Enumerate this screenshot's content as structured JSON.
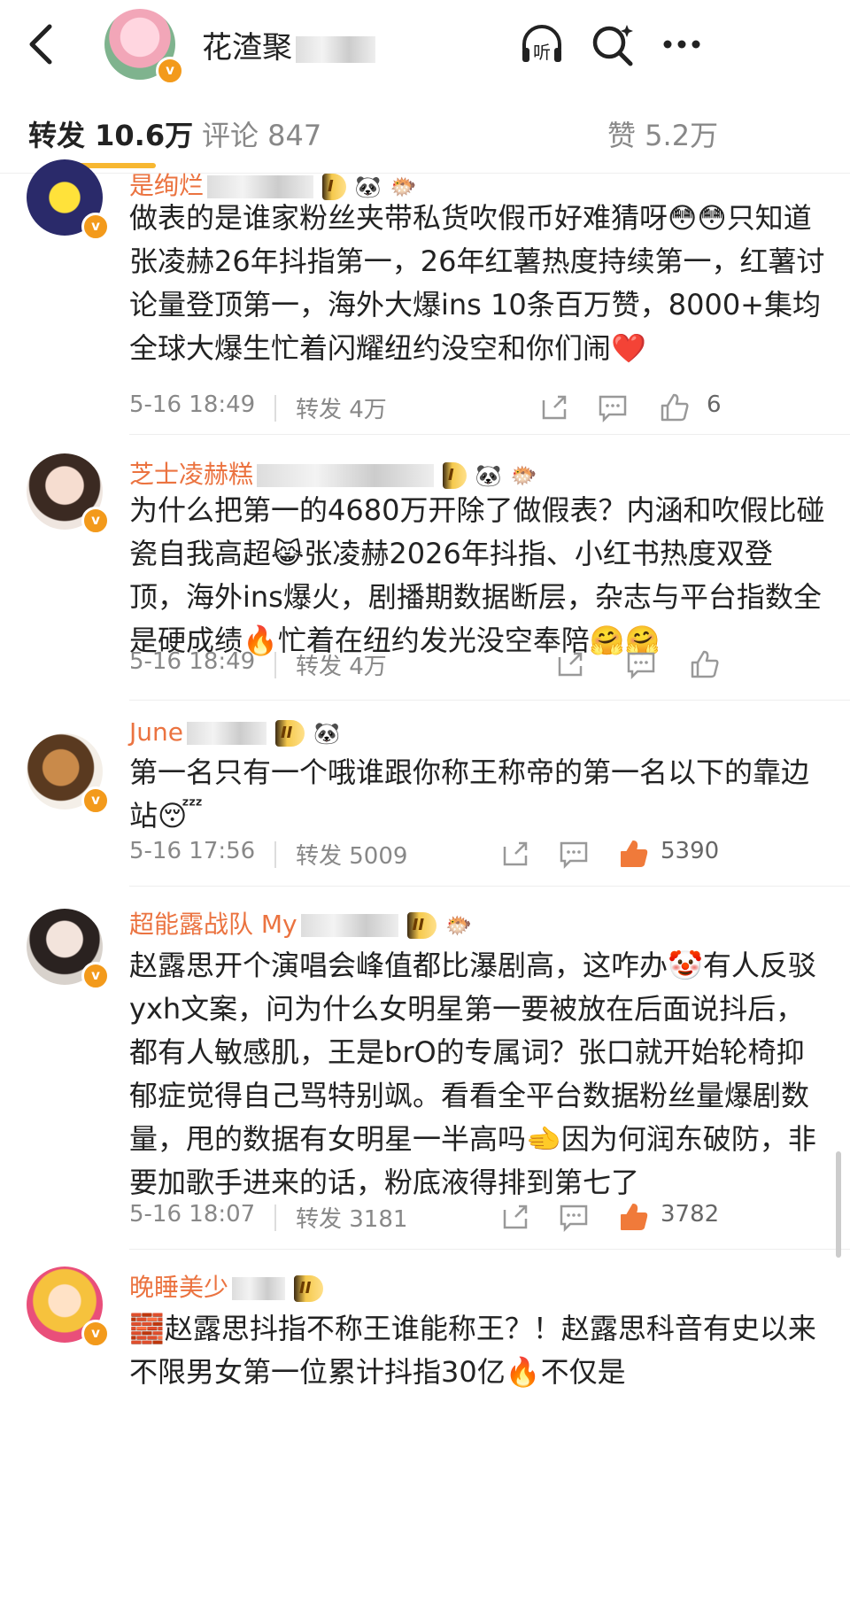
{
  "header": {
    "title": "花渣聚",
    "listen_label": "听"
  },
  "tabs": [
    {
      "label": "转发 10.6万",
      "active": true
    },
    {
      "label": "评论 847",
      "active": false
    },
    {
      "label": "赞 5.2万",
      "active": false
    }
  ],
  "comments": [
    {
      "name": "是绚烂",
      "badge": "I",
      "text": "做表的是谁家粉丝夹带私货吹假币好难猜呀😳😳只知道张凌赫26年抖指第一，26年红薯热度持续第一，红薯讨论量登顶第一，海外大爆ins 10条百万赞，8000+集均全球大爆生忙着闪耀纽约没空和你们闹❤️",
      "time": "5-16 18:49",
      "repost": "转发 4万",
      "likes": "6"
    },
    {
      "name": "芝士凌赫糕",
      "badge": "I",
      "text": "为什么把第一的4680万开除了做假表？内涵和吹假比碰瓷自我高超😹张凌赫2026年抖指、小红书热度双登顶，海外ins爆火，剧播期数据断层，杂志与平台指数全是硬成绩🔥忙着在纽约发光没空奉陪🤗🤗",
      "time": "5-16 18:49",
      "repost": "转发 4万",
      "likes": ""
    },
    {
      "name": "June",
      "badge": "II",
      "text": "第一名只有一个哦谁跟你称王称帝的第一名以下的靠边站😴",
      "time": "5-16 17:56",
      "repost": "转发 5009",
      "likes": "5390"
    },
    {
      "name": "超能露战队 My",
      "badge": "II",
      "text": "赵露思开个演唱会峰值都比瀑剧高，这咋办🤡有人反驳yxh文案，问为什么女明星第一要被放在后面说抖后，都有人敏感肌，王是brO的专属词？张口就开始轮椅抑郁症觉得自己骂特别飒。看看全平台数据粉丝量爆剧数量，甩的数据有女明星一半高吗🫲因为何润东破防，非要加歌手进来的话，粉底液得排到第七了",
      "time": "5-16 18:07",
      "repost": "转发 3181",
      "likes": "3782"
    },
    {
      "name": "晚睡美少",
      "badge": "II",
      "text": "🧱赵露思抖指不称王谁能称王？！赵露思科音有史以来不限男女第一位累计抖指30亿🔥不仅是",
      "time": "",
      "repost": "",
      "likes": ""
    }
  ],
  "colors": {
    "name_orange": "#eb7340",
    "like_active": "#f07a3a",
    "tab_underline": "#f7b731",
    "vbadge": "#f39a1b"
  },
  "icons": [
    "back-arrow-icon",
    "headphone-icon",
    "search-icon",
    "more-icon",
    "share-icon",
    "comment-icon",
    "like-icon"
  ]
}
